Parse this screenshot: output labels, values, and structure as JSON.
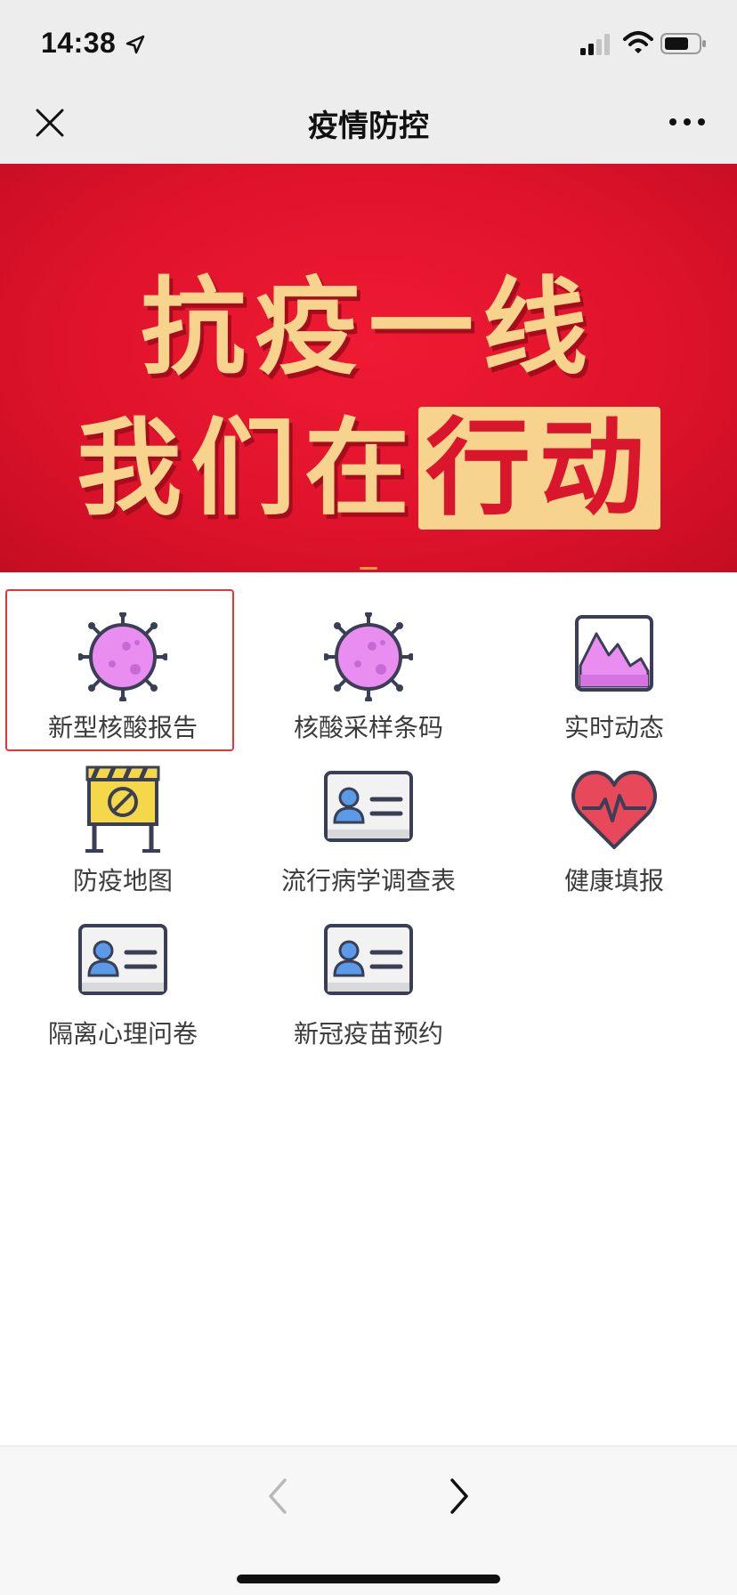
{
  "status_bar": {
    "time": "14:38"
  },
  "nav": {
    "title": "疫情防控"
  },
  "banner": {
    "line1": "抗疫一线",
    "line2_plain": "我们在",
    "line2_highlight": "行动"
  },
  "grid": {
    "items": [
      {
        "label": "新型核酸报告",
        "icon": "virus-icon"
      },
      {
        "label": "核酸采样条码",
        "icon": "virus-icon"
      },
      {
        "label": "实时动态",
        "icon": "chart-icon"
      },
      {
        "label": "防疫地图",
        "icon": "barrier-icon"
      },
      {
        "label": "流行病学调查表",
        "icon": "id-card-icon"
      },
      {
        "label": "健康填报",
        "icon": "heartbeat-icon"
      },
      {
        "label": "隔离心理问卷",
        "icon": "id-card-icon"
      },
      {
        "label": "新冠疫苗预约",
        "icon": "id-card-icon"
      }
    ]
  },
  "colors": {
    "banner_red": "#e0132c",
    "banner_text": "#f7d48e",
    "virus_purple": "#e98ef0",
    "selection_red": "#e6353a",
    "heart_red": "#e7485a"
  }
}
